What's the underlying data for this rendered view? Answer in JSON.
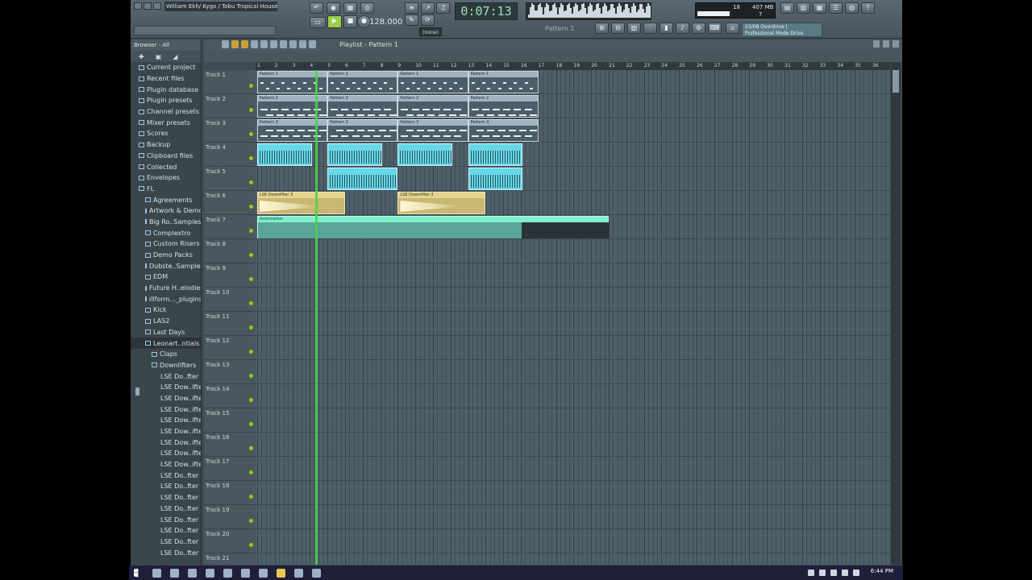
{
  "toolbar": {
    "song_title": "William Ekh/ Kygo / Tobu Tropical House",
    "time": "0:07:13",
    "tempo": "128.000",
    "pattern_label": "Pattern 1",
    "none_label": "(none)",
    "cpu": "18",
    "memory": "407 MB",
    "voices": "7",
    "hint_line1": "03/08  Overdrive |",
    "hint_line2": "Professional Mode Drive"
  },
  "browser": {
    "header": "Browser - All",
    "items": [
      {
        "label": "Current project",
        "type": "folder",
        "indent": 0
      },
      {
        "label": "Recent files",
        "type": "folder",
        "indent": 0
      },
      {
        "label": "Plugin database",
        "type": "folder",
        "indent": 0
      },
      {
        "label": "Plugin presets",
        "type": "folder",
        "indent": 0
      },
      {
        "label": "Channel presets",
        "type": "folder",
        "indent": 0
      },
      {
        "label": "Mixer presets",
        "type": "folder",
        "indent": 0
      },
      {
        "label": "Scores",
        "type": "folder",
        "indent": 0
      },
      {
        "label": "Backup",
        "type": "folder",
        "indent": 0
      },
      {
        "label": "Clipboard files",
        "type": "folder",
        "indent": 0
      },
      {
        "label": "Collected",
        "type": "folder",
        "indent": 0
      },
      {
        "label": "Envelopes",
        "type": "folder",
        "indent": 0
      },
      {
        "label": "FL",
        "type": "folder",
        "indent": 0
      },
      {
        "label": "Agreements",
        "type": "folder",
        "indent": 1
      },
      {
        "label": "Artwork & Demo",
        "type": "folder",
        "indent": 1
      },
      {
        "label": "Big Ro..Samples",
        "type": "folder",
        "indent": 1
      },
      {
        "label": "Complextro",
        "type": "folder",
        "indent": 1
      },
      {
        "label": "Custom Risers",
        "type": "folder",
        "indent": 1
      },
      {
        "label": "Demo Packs",
        "type": "folder",
        "indent": 1
      },
      {
        "label": "Dubste..Samples",
        "type": "folder",
        "indent": 1
      },
      {
        "label": "EDM",
        "type": "folder",
        "indent": 1
      },
      {
        "label": "Future H..elodies",
        "type": "folder",
        "indent": 1
      },
      {
        "label": "illform..._plugins",
        "type": "folder",
        "indent": 1
      },
      {
        "label": "Kick",
        "type": "folder",
        "indent": 1
      },
      {
        "label": "LAS2",
        "type": "folder",
        "indent": 1
      },
      {
        "label": "Last Days",
        "type": "folder",
        "indent": 1
      },
      {
        "label": "Leonart..ntials",
        "type": "folder",
        "indent": 1,
        "selected": true
      },
      {
        "label": "Claps",
        "type": "folder",
        "indent": 2
      },
      {
        "label": "Downlifters",
        "type": "folder",
        "indent": 2
      },
      {
        "label": "LSE Do..fter 1",
        "type": "file",
        "indent": 3
      },
      {
        "label": "LSE Dow..ifter 2",
        "type": "file",
        "indent": 3
      },
      {
        "label": "LSE Dow..ifter 3",
        "type": "file",
        "indent": 3
      },
      {
        "label": "LSE Dow..ifter 4",
        "type": "file",
        "indent": 3
      },
      {
        "label": "LSE Dow..ifter 5",
        "type": "file",
        "indent": 3
      },
      {
        "label": "LSE Dow..ifter 6",
        "type": "file",
        "indent": 3
      },
      {
        "label": "LSE Dow..ifter 7",
        "type": "file",
        "indent": 3
      },
      {
        "label": "LSE Dow..ifter 8",
        "type": "file",
        "indent": 3
      },
      {
        "label": "LSE Dow..ifter 9",
        "type": "file",
        "indent": 3
      },
      {
        "label": "LSE Do..fter 10",
        "type": "file",
        "indent": 3
      },
      {
        "label": "LSE Do..fter 11",
        "type": "file",
        "indent": 3
      },
      {
        "label": "LSE Do..fter 12",
        "type": "file",
        "indent": 3
      },
      {
        "label": "LSE Do..fter 13",
        "type": "file",
        "indent": 3
      },
      {
        "label": "LSE Do..fter 14",
        "type": "file",
        "indent": 3
      },
      {
        "label": "LSE Do..fter 15",
        "type": "file",
        "indent": 3
      },
      {
        "label": "LSE Do..fter 16",
        "type": "file",
        "indent": 3
      },
      {
        "label": "LSE Do..fter 17",
        "type": "file",
        "indent": 3
      }
    ]
  },
  "playlist": {
    "title": "Playlist - Pattern 1",
    "bars": [
      "1",
      "2",
      "3",
      "4",
      "5",
      "6",
      "7",
      "8",
      "9",
      "10",
      "11",
      "12",
      "13",
      "14",
      "15",
      "16",
      "17",
      "18",
      "19",
      "20",
      "21",
      "22",
      "23",
      "24",
      "25",
      "26",
      "27",
      "28",
      "29",
      "30",
      "31",
      "32",
      "33",
      "34",
      "35",
      "36"
    ],
    "tracks": [
      "Track 1",
      "Track 2",
      "Track 3",
      "Track 4",
      "Track 5",
      "Track 6",
      "Track 7",
      "Track 8",
      "Track 9",
      "Track 10",
      "Track 11",
      "Track 12",
      "Track 13",
      "Track 14",
      "Track 15",
      "Track 16",
      "Track 17",
      "Track 18",
      "Track 19",
      "Track 20",
      "Track 21"
    ],
    "pattern_clips": [
      {
        "track": 1,
        "label": "Pattern 1",
        "start": 1,
        "end": 5
      },
      {
        "track": 1,
        "label": "Pattern 1",
        "start": 5,
        "end": 9
      },
      {
        "track": 1,
        "label": "Pattern 1",
        "start": 9,
        "end": 13
      },
      {
        "track": 1,
        "label": "Pattern 1",
        "start": 13,
        "end": 17
      },
      {
        "track": 2,
        "label": "Pattern 2",
        "start": 1,
        "end": 5
      },
      {
        "track": 2,
        "label": "Pattern 2",
        "start": 5,
        "end": 9
      },
      {
        "track": 2,
        "label": "Pattern 2",
        "start": 9,
        "end": 13
      },
      {
        "track": 2,
        "label": "Pattern 2",
        "start": 13,
        "end": 17
      },
      {
        "track": 3,
        "label": "Pattern 3",
        "start": 1,
        "end": 5
      },
      {
        "track": 3,
        "label": "Pattern 3",
        "start": 5,
        "end": 9
      },
      {
        "track": 3,
        "label": "Pattern 3",
        "start": 9,
        "end": 13
      },
      {
        "track": 3,
        "label": "Pattern 3",
        "start": 13,
        "end": 17
      }
    ],
    "audio_clips": [
      {
        "track": 4,
        "start": 1,
        "end": 4.1
      },
      {
        "track": 4,
        "start": 5,
        "end": 8.1
      },
      {
        "track": 4,
        "start": 9,
        "end": 12.1
      },
      {
        "track": 4,
        "start": 13,
        "end": 16.1
      },
      {
        "track": 5,
        "start": 5,
        "end": 9
      },
      {
        "track": 5,
        "start": 13,
        "end": 16.1
      }
    ],
    "downlifter_clips": [
      {
        "track": 6,
        "label": "LSE Downlifter 3",
        "start": 1,
        "end": 6
      },
      {
        "track": 6,
        "label": "LSE Downlifter 3",
        "start": 9,
        "end": 14
      }
    ],
    "automation_clip": {
      "track": 7,
      "start": 1,
      "end": 21,
      "label": "Automation"
    },
    "playhead_bar": 4.3
  },
  "taskbar": {
    "clock": "6:44 PM"
  },
  "colors": {
    "accent": "#4fd14a",
    "audio": "#67d8e8",
    "automation": "#3ed9b0",
    "downlifter": "#c8b874",
    "taskbar": "#1f1f3a"
  }
}
